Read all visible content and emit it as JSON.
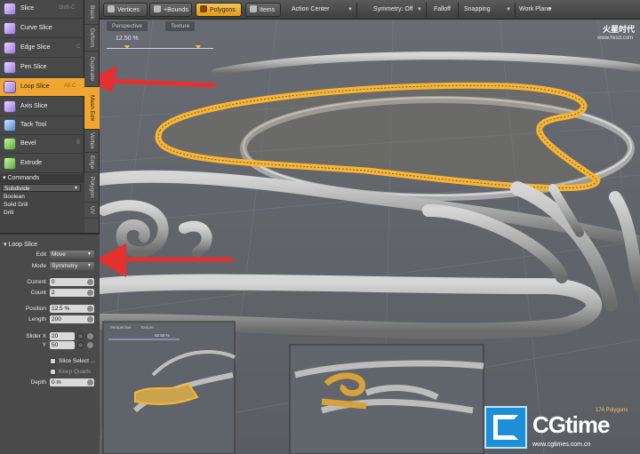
{
  "toolbar": {
    "buttons": [
      {
        "label": "Vertices",
        "active": false
      },
      {
        "label": "+Bounds",
        "active": false
      },
      {
        "label": "Polygons",
        "active": true
      },
      {
        "label": "Items",
        "active": false
      }
    ],
    "dropdowns": [
      "Action Center",
      "Symmetry: Off",
      "Falloff",
      "Snapping",
      "Work Plane"
    ]
  },
  "tools": [
    {
      "label": "Slice",
      "key": "Shift-C",
      "icon": "slice-icon",
      "selected": false
    },
    {
      "label": "Curve Slice",
      "key": "",
      "icon": "curve-slice-icon",
      "selected": false
    },
    {
      "label": "Edge Slice",
      "key": "C",
      "icon": "edge-slice-icon",
      "selected": false
    },
    {
      "label": "Pen Slice",
      "key": "",
      "icon": "pen-slice-icon",
      "selected": false
    },
    {
      "label": "Loop Slice",
      "key": "Alt-C",
      "icon": "loop-slice-icon",
      "selected": true
    },
    {
      "label": "Axis Slice",
      "key": "",
      "icon": "axis-slice-icon",
      "selected": false
    },
    {
      "label": "Tack Tool",
      "key": "",
      "icon": "tack-tool-icon",
      "selected": false
    },
    {
      "label": "Bevel",
      "key": "B",
      "icon": "bevel-icon",
      "selected": false
    },
    {
      "label": "Extrude",
      "key": "",
      "icon": "extrude-icon",
      "selected": false
    }
  ],
  "vertical_tabs": [
    "Basic",
    "Deform",
    "Duplicate",
    "Mesh Edit",
    "Vertex",
    "Edge",
    "Polygon",
    "UV"
  ],
  "commands": {
    "title": "Commands",
    "items": [
      "Subdivide",
      "Boolean",
      "Solid Drill",
      "Drill"
    ]
  },
  "properties": {
    "title": "Loop Slice",
    "edit_label": "Edit",
    "edit_value": "Move",
    "mode_label": "Mode",
    "mode_value": "Symmetry",
    "current_label": "Current",
    "current_value": "0",
    "count_label": "Count",
    "count_value": "2",
    "position_label": "Position",
    "position_value": "12.5 %",
    "length_label": "Length",
    "length_value": "200",
    "sliderx_label": "Slider X",
    "sliderx_value": "20",
    "y_label": "Y",
    "y_value": "50",
    "slice_select_label": "Slice Select ...",
    "keep_quads_label": "Keep Quads",
    "depth_label": "Depth",
    "depth_value": "0 m"
  },
  "viewport": {
    "tabs": [
      "Perspective",
      "Texture"
    ],
    "slider_value": "12.50 %",
    "inset_slider_value": "62.50 %",
    "polygon_info": "174 Polygons"
  },
  "watermark": {
    "top_text": "火星时代",
    "top_url": "www.hxsd.com",
    "bottom_text": "CGtime",
    "bottom_url": "www.cgtimes.com.cn"
  },
  "colors": {
    "accent": "#f0a630",
    "selection": "#f5b538",
    "arrow": "#e53030"
  }
}
